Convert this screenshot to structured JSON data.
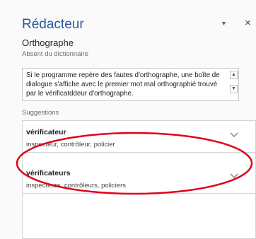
{
  "pane": {
    "title": "Rédacteur",
    "menu_icon": "dropdown-arrow-icon",
    "close_label": "×",
    "section": "Orthographe",
    "subtitle": "Absent du dictionnaire",
    "context_text": "Si le programme repère des fautes d'orthographe, une boîte de dialogue s'affiche avec le premier mot mal orthographié trouvé par le vérificatddeur d'orthographe.",
    "suggestions_label": "Suggestions",
    "suggestions": [
      {
        "word": "vérificateur",
        "synonyms": "inspecteur, contrôleur, policier"
      },
      {
        "word": "vérificateurs",
        "synonyms": "inspecteurs, contrôleurs, policiers"
      }
    ]
  },
  "colors": {
    "title": "#2b579a",
    "annotation_ellipse": "#e0001b"
  }
}
